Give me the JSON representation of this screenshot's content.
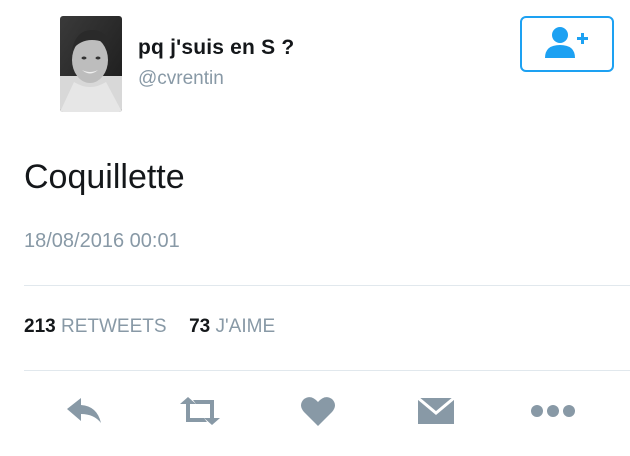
{
  "user": {
    "name": "pq j'suis en S ?",
    "handle": "@cvrentin"
  },
  "tweet": {
    "text": "Coquillette",
    "timestamp": "18/08/2016 00:01"
  },
  "stats": {
    "retweets_count": "213",
    "retweets_label": "RETWEETS",
    "likes_count": "73",
    "likes_label": "J'AIME"
  },
  "icons": {
    "follow": "add-user-icon",
    "reply": "reply-icon",
    "retweet": "retweet-icon",
    "like": "heart-icon",
    "message": "envelope-icon",
    "more": "more-icon"
  },
  "colors": {
    "accent": "#1da1f2",
    "secondary_text": "#8899a6",
    "action_icon": "#8899a6",
    "primary_text": "#14171a"
  }
}
